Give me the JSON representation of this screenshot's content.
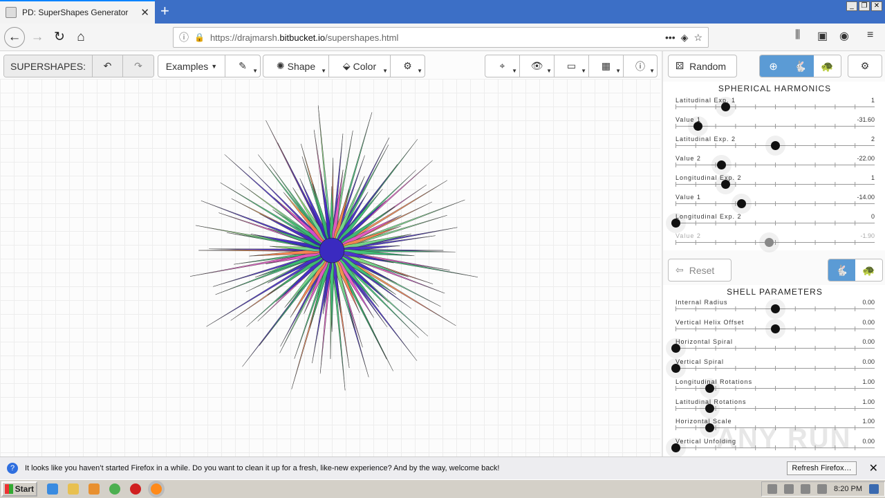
{
  "browser": {
    "tab_title": "PD: SuperShapes Generator",
    "tab_close": "✕",
    "new_tab": "+",
    "url_prefix": "https://drajmarsh.",
    "url_domain": "bitbucket.io",
    "url_path": "/supershapes.html",
    "url_more": "•••"
  },
  "toolbar": {
    "app_label": "SUPERSHAPES:",
    "examples_label": "Examples",
    "shape_label": "Shape",
    "color_label": "Color"
  },
  "panel": {
    "random_label": "Random",
    "reset_label": "Reset",
    "spherical_title": "SPHERICAL HARMONICS",
    "shell_title": "SHELL PARAMETERS",
    "harmonics": [
      {
        "label": "Latitudinal Exp. 1",
        "value": "1",
        "level": 0.25,
        "dim": false
      },
      {
        "label": "Value 1",
        "value": "-31.60",
        "level": 0.11,
        "dim": false
      },
      {
        "label": "Latitudinal Exp. 2",
        "value": "2",
        "level": 0.5,
        "dim": false
      },
      {
        "label": "Value 2",
        "value": "-22.00",
        "level": 0.23,
        "dim": false
      },
      {
        "label": "Longitudinal Exp. 2",
        "value": "1",
        "level": 0.25,
        "dim": false
      },
      {
        "label": "Value 1",
        "value": "-14.00",
        "level": 0.33,
        "dim": false
      },
      {
        "label": "Longitudinal Exp. 2",
        "value": "0",
        "level": 0.0,
        "dim": false
      },
      {
        "label": "Value 2",
        "value": "-1.90",
        "level": 0.47,
        "dim": true
      }
    ],
    "shell": [
      {
        "label": "Internal Radius",
        "value": "0.00",
        "level": 0.5
      },
      {
        "label": "Vertical Helix Offset",
        "value": "0.00",
        "level": 0.5
      },
      {
        "label": "Horizontal Spiral",
        "value": "0.00",
        "level": 0.0
      },
      {
        "label": "Vertical Spiral",
        "value": "0.00",
        "level": 0.0
      },
      {
        "label": "Longitudinal Rotations",
        "value": "1.00",
        "level": 0.17
      },
      {
        "label": "Latitudinal Rotations",
        "value": "1.00",
        "level": 0.17
      },
      {
        "label": "Horizontal Scale",
        "value": "1.00",
        "level": 0.17
      },
      {
        "label": "Vertical Unfolding",
        "value": "0.00",
        "level": 0.0
      }
    ]
  },
  "notification": {
    "message": "It looks like you haven’t started Firefox in a while. Do you want to clean it up for a fresh, like-new experience? And by the way, welcome back!",
    "button": "Refresh Firefox…",
    "close": "✕"
  },
  "taskbar": {
    "start_label": "Start",
    "clock": "8:20 PM"
  },
  "watermark": "ANY RUN",
  "colors": {
    "accent": "#5b9bd5",
    "tabbar": "#3c6fc6",
    "lock": "#12bc00"
  }
}
